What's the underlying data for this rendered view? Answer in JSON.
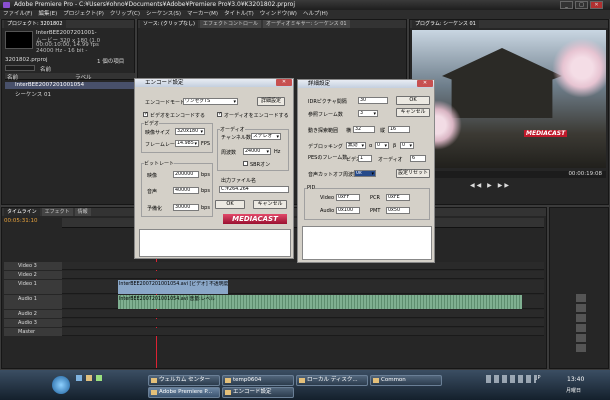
{
  "window": {
    "title": "Adobe Premiere Pro - C:¥Users¥ohno¥Documents¥Adobe¥Premiere Pro¥3.0¥K3201802.prproj",
    "min": "_",
    "max": "□",
    "close": "✕"
  },
  "menu": [
    "ファイル(F)",
    "編集(E)",
    "プロジェクト(P)",
    "クリップ(C)",
    "シーケンス(S)",
    "マーカー(M)",
    "タイトル(T)",
    "ウィンドウ(W)",
    "ヘルプ(H)"
  ],
  "project": {
    "tab": "プロジェクト: 3201802",
    "clip_name": "InterBEE2007201001-",
    "info_lines": [
      "ムービー 320 x 180 (1.0",
      "00:00:10:00, 14.99 fps",
      "24000 Hz - 16 bit -"
    ],
    "project_file": "3201802.prproj",
    "item_count": "1 個の項目",
    "col_name": "名前",
    "col_label": "ラベル",
    "items": [
      "InterBEE2007201001054",
      "シーケンス 01"
    ],
    "col_unknown": "名前"
  },
  "source_tabs": [
    "ソース: (クリップなし)",
    "エフェクトコントロール",
    "オーディオミキサー: シーケンス 01"
  ],
  "program": {
    "tab": "プログラム: シーケンス 01",
    "timecode": "00:00:19:08",
    "overlay": "MEDIACAST"
  },
  "timeline": {
    "tabs": [
      "タイムライン",
      "エフェクト",
      "情報"
    ],
    "timecode": "00:05:31:10",
    "tracks": [
      "Video 3",
      "Video 2",
      "Video 1",
      "Audio 1",
      "Audio 2",
      "Audio 3",
      "Master"
    ],
    "video_clip": "InterBEE2007201001054.avi [ビデオ] 不透明度:不透明度",
    "audio_clip": "InterBEE2007201001054.avi 音量:レベル"
  },
  "encode_dialog": {
    "title": "エンコード設定",
    "mode_label": "エンコードモード",
    "mode_value": "ワンセグTS",
    "detail_button": "詳細設定",
    "video_checkbox": "ビデオをエンコードする",
    "audio_checkbox": "オーディオをエンコードする",
    "video_group": "ビデオ",
    "size_label": "映像サイズ",
    "size_value": "320x180",
    "framerate_label": "フレームレート",
    "framerate_value": "14.985",
    "fps": "FPS",
    "audio_group": "オーディオ",
    "channels_label": "チャンネル数",
    "channels_value": "ステレオ",
    "freq_label": "周波数",
    "freq_value": "24000",
    "hz": "Hz",
    "sbr_checkbox": "SBRオン",
    "bitrate_group": "ビットレート",
    "video_br_label": "映像",
    "video_br_value": "200000",
    "audio_br_label": "音声",
    "audio_br_value": "40000",
    "reserve_label": "予備化",
    "reserve_value": "30000",
    "bps": "bps",
    "output_label": "出力ファイル名",
    "output_value": "C:¥264.264",
    "ok": "OK",
    "cancel": "キャンセル",
    "logo": "MEDIACAST"
  },
  "detail_dialog": {
    "title": "詳細設定",
    "idr_label": "IDRピクチャ間隔",
    "idr_value": "30",
    "ok": "OK",
    "ref_label": "参照フレーム数",
    "ref_value": "3",
    "cancel": "キャンセル",
    "motion_label": "動き探索範囲",
    "motion_h_label": "横",
    "motion_h": "32",
    "motion_v_label": "縦",
    "motion_v": "16",
    "deblock_label": "デブロッキング",
    "deblock_value": "無効",
    "a_label": "α",
    "a_value": "0",
    "b_label": "β",
    "b_value": "0",
    "pes_label": "PESのフレーム数",
    "pes_video_label": "ビデオ",
    "pes_video": "1",
    "pes_audio_label": "オーディオ",
    "pes_audio": "6",
    "cut_label": "音声カットオフ周波数",
    "cut_value": "0k",
    "reset": "設定リセット",
    "pid_group": "PID",
    "video_pid_label": "Video",
    "video_pid": "0xFF",
    "pcr_label": "PCR",
    "pcr": "0xFE",
    "audio_pid_label": "Audio",
    "audio_pid": "0x100",
    "pmt_label": "PMT",
    "pmt": "0x50"
  },
  "taskbar": {
    "items": [
      "ウェルカム センター",
      "temp0604",
      "ローカル ディスク...",
      "Common",
      "Adobe Premiere P...",
      "エンコード設定"
    ],
    "time": "13:40",
    "day": "月曜日",
    "lang": "JP"
  }
}
